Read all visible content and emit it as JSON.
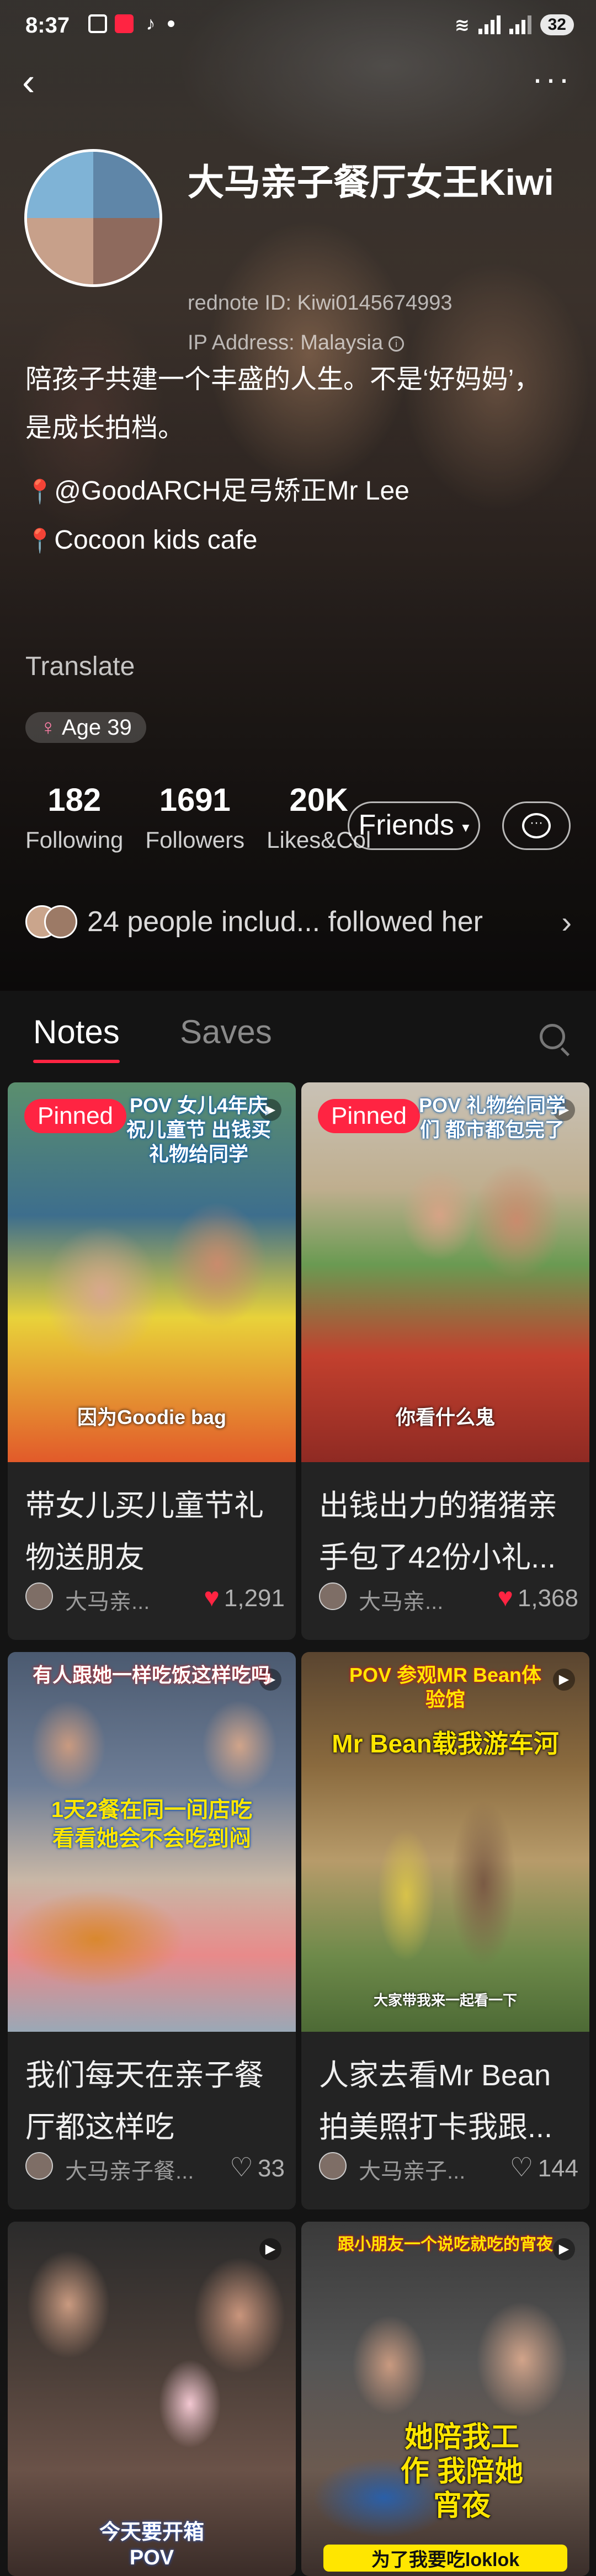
{
  "status_bar": {
    "time": "8:37",
    "battery": "32"
  },
  "profile": {
    "name": "大马亲子餐厅女王Kiwi",
    "red_id": "rednote ID: Kiwi0145674993",
    "ip": "IP Address: Malaysia",
    "bio_lines": [
      "陪孩子共建一个丰盛的人生。不是‘好妈妈’，",
      "是成长拍档。",
      "",
      "@GoodARCH足弓矫正Mr Lee",
      "Cocoon kids cafe"
    ],
    "translate_label": "Translate",
    "age_badge": "Age 39",
    "stats": {
      "following_num": "182",
      "following_label": "Following",
      "followers_num": "1691",
      "followers_label": "Followers",
      "likes_num": "20K",
      "likes_label": "Likes&Col"
    },
    "friends_label": "Friends",
    "followed_text": "24 people includ... followed her"
  },
  "tabs": {
    "notes": "Notes",
    "saves": "Saves"
  },
  "notes": [
    {
      "pinned": "Pinned",
      "overlay_top": "POV 女儿4年庆祝儿童节 出钱买礼物给同学",
      "overlay_bottom": "因为Goodie bag",
      "title": "带女儿买儿童节礼物送朋友",
      "author": "大马亲...",
      "likes": "1,291"
    },
    {
      "pinned": "Pinned",
      "overlay_top": "POV 礼物给同学们 都市都包完了",
      "overlay_bottom": "你看什么鬼",
      "title": "出钱出力的猪猪亲手包了42份小礼...",
      "author": "大马亲...",
      "likes": "1,368"
    },
    {
      "overlay_top": "有人跟她一样吃饭这样吃吗",
      "overlay_mid": "1天2餐在同一间店吃 看看她会不会吃到闷",
      "title": "我们每天在亲子餐厅都这样吃",
      "author": "大马亲子餐...",
      "likes": "33"
    },
    {
      "overlay_top": "POV 参观MR Bean体验馆",
      "overlay_mid": "Mr Bean载我游车河",
      "overlay_bottom": "大家带我来一起看一下",
      "title": "人家去看Mr Bean拍美照打卡我跟...",
      "author": "大马亲子...",
      "likes": "144"
    },
    {
      "overlay_bottom": "今天要开箱 POV"
    },
    {
      "overlay_top": "跟小朋友一个说吃就吃的宵夜",
      "overlay_mid": "她陪我工作 我陪她宵夜",
      "overlay_bottom": "为了我要吃loklok"
    }
  ],
  "colors": {
    "accent": "#ff2442",
    "background": "#141414",
    "card": "#232323"
  }
}
